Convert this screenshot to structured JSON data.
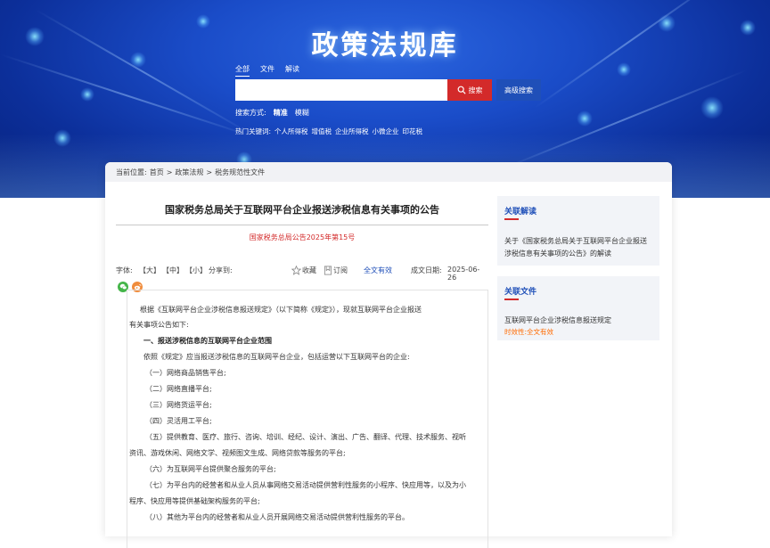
{
  "site": {
    "title": "政策法规库"
  },
  "search": {
    "tabs": [
      {
        "label": "全部",
        "active": true
      },
      {
        "label": "文件",
        "active": false
      },
      {
        "label": "解读",
        "active": false
      }
    ],
    "query": "",
    "search_label": "搜索",
    "search_icon": "search-icon",
    "advanced_label": "高级搜索",
    "mode_prefix": "搜索方式:",
    "modes": [
      {
        "label": "精准",
        "active": true
      },
      {
        "label": "模糊",
        "active": false
      }
    ],
    "hot_prefix": "热门关键词:",
    "hot_keywords": [
      "个人所得税",
      "增值税",
      "企业所得税",
      "小微企业",
      "印花税"
    ]
  },
  "breadcrumb": {
    "prefix": "当前位置:",
    "items": [
      "首页",
      "政策法规",
      "税务规范性文件"
    ],
    "separator": ">"
  },
  "article": {
    "title": "国家税务总局关于互联网平台企业报送涉税信息有关事项的公告",
    "doc_number": "国家税务总局公告2025年第15号",
    "font_label": "字体:",
    "font_sizes": [
      "【大】",
      "【中】",
      "【小】"
    ],
    "share_label": "分享到:",
    "favorite_label": "收藏",
    "subscribe_label": "订阅",
    "validity": "全文有效",
    "date_label": "成文日期:",
    "date": "2025-06-26",
    "paragraphs": [
      "根据《互联网平台企业涉税信息报送规定》（以下简称《规定》），现就互联网平台企业报送",
      "有关事项公告如下:",
      "一、报送涉税信息的互联网平台企业范围",
      "依照《规定》应当报送涉税信息的互联网平台企业，包括运营以下互联网平台的企业:",
      "（一）网络商品销售平台;",
      "（二）网络直播平台;",
      "（三）网络货运平台;",
      "（四）灵活用工平台;",
      "（五）提供教育、医疗、旅行、咨询、培训、经纪、设计、演出、广告、翻译、代理、技术服务、视听",
      "资讯、游戏休闲、网络文学、视频图文生成、网络贷款等服务的平台;",
      "（六）为互联网平台提供聚合服务的平台;",
      "（七）为平台内的经营者和从业人员从事网络交易活动提供营利性服务的小程序、快应用等，以及为小",
      "程序、快应用等提供基础架构服务的平台;",
      "（八）其他为平台内的经营者和从业人员开展网络交易活动提供营利性服务的平台。"
    ]
  },
  "sidebar": {
    "related_reading": {
      "heading": "关联解读",
      "items": [
        "关于《国家税务总局关于互联网平台企业报送",
        "涉税信息有关事项的公告》的解读"
      ]
    },
    "related_files": {
      "heading": "关联文件",
      "item": "互联网平台企业涉税信息报送规定",
      "status_prefix": "时效性:",
      "status": "全文有效"
    }
  },
  "colors": {
    "accent_red": "#d32a2a",
    "brand_blue": "#1f4fb8",
    "status_orange": "#ff6a00"
  }
}
